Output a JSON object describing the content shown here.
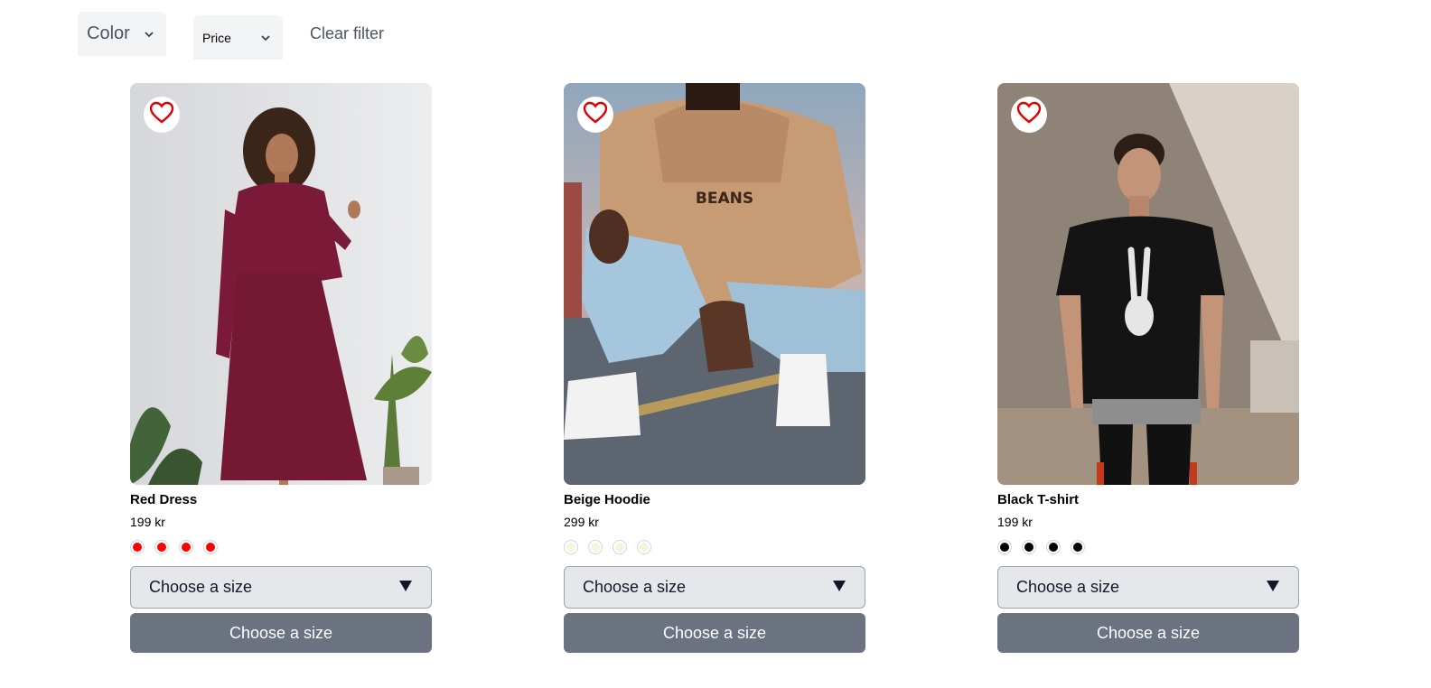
{
  "filters": {
    "color_label": "Color",
    "price_label": "Price",
    "clear_label": "Clear filter"
  },
  "products": [
    {
      "name": "Red Dress",
      "price": "199 kr",
      "swatch_color": "#ff0000",
      "size_placeholder": "Choose a size",
      "button_label": "Choose a size"
    },
    {
      "name": "Beige Hoodie",
      "price": "299 kr",
      "swatch_color": "#f5f5dc",
      "size_placeholder": "Choose a size",
      "button_label": "Choose a size"
    },
    {
      "name": "Black T-shirt",
      "price": "199 kr",
      "swatch_color": "#000000",
      "size_placeholder": "Choose a size",
      "button_label": "Choose a size"
    }
  ],
  "colors": {
    "favorite": "#e00000",
    "button_bg": "#6b7280",
    "select_bg": "#e5e7eb"
  }
}
